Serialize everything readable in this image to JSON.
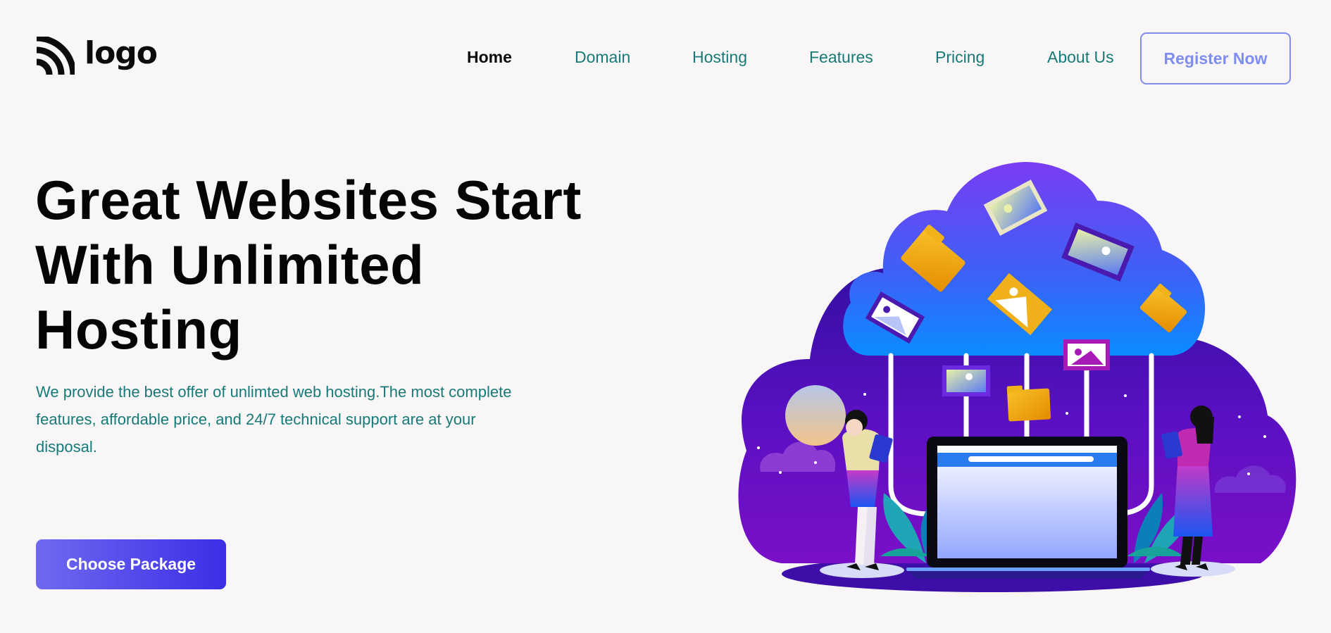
{
  "brand": {
    "logo_text": "logo"
  },
  "nav": {
    "items": [
      {
        "label": "Home",
        "active": true
      },
      {
        "label": "Domain"
      },
      {
        "label": "Hosting"
      },
      {
        "label": "Features"
      },
      {
        "label": "Pricing"
      },
      {
        "label": "About Us"
      }
    ],
    "register_label": "Register Now"
  },
  "hero": {
    "title_line1": "Great Websites Start",
    "title_line2": "With Unlimited",
    "title_line3": "Hosting",
    "description": "We provide the best offer of unlimted web hosting.The most complete features, affordable price, and 24/7 technical support are at your disposal.",
    "cta_label": "Choose Package"
  },
  "colors": {
    "background": "#f8f6f6",
    "nav_text": "#177a78",
    "accent_outline": "#7f8df2",
    "cta_gradient_start": "#6e6af0",
    "cta_gradient_end": "#3b2ee6",
    "illustration_cloud": "#6a3df2",
    "illustration_ground": "#4a0fb5"
  },
  "icons": {
    "logo": "signal-arcs-icon",
    "illustration": "cloud-hosting-illustration"
  }
}
